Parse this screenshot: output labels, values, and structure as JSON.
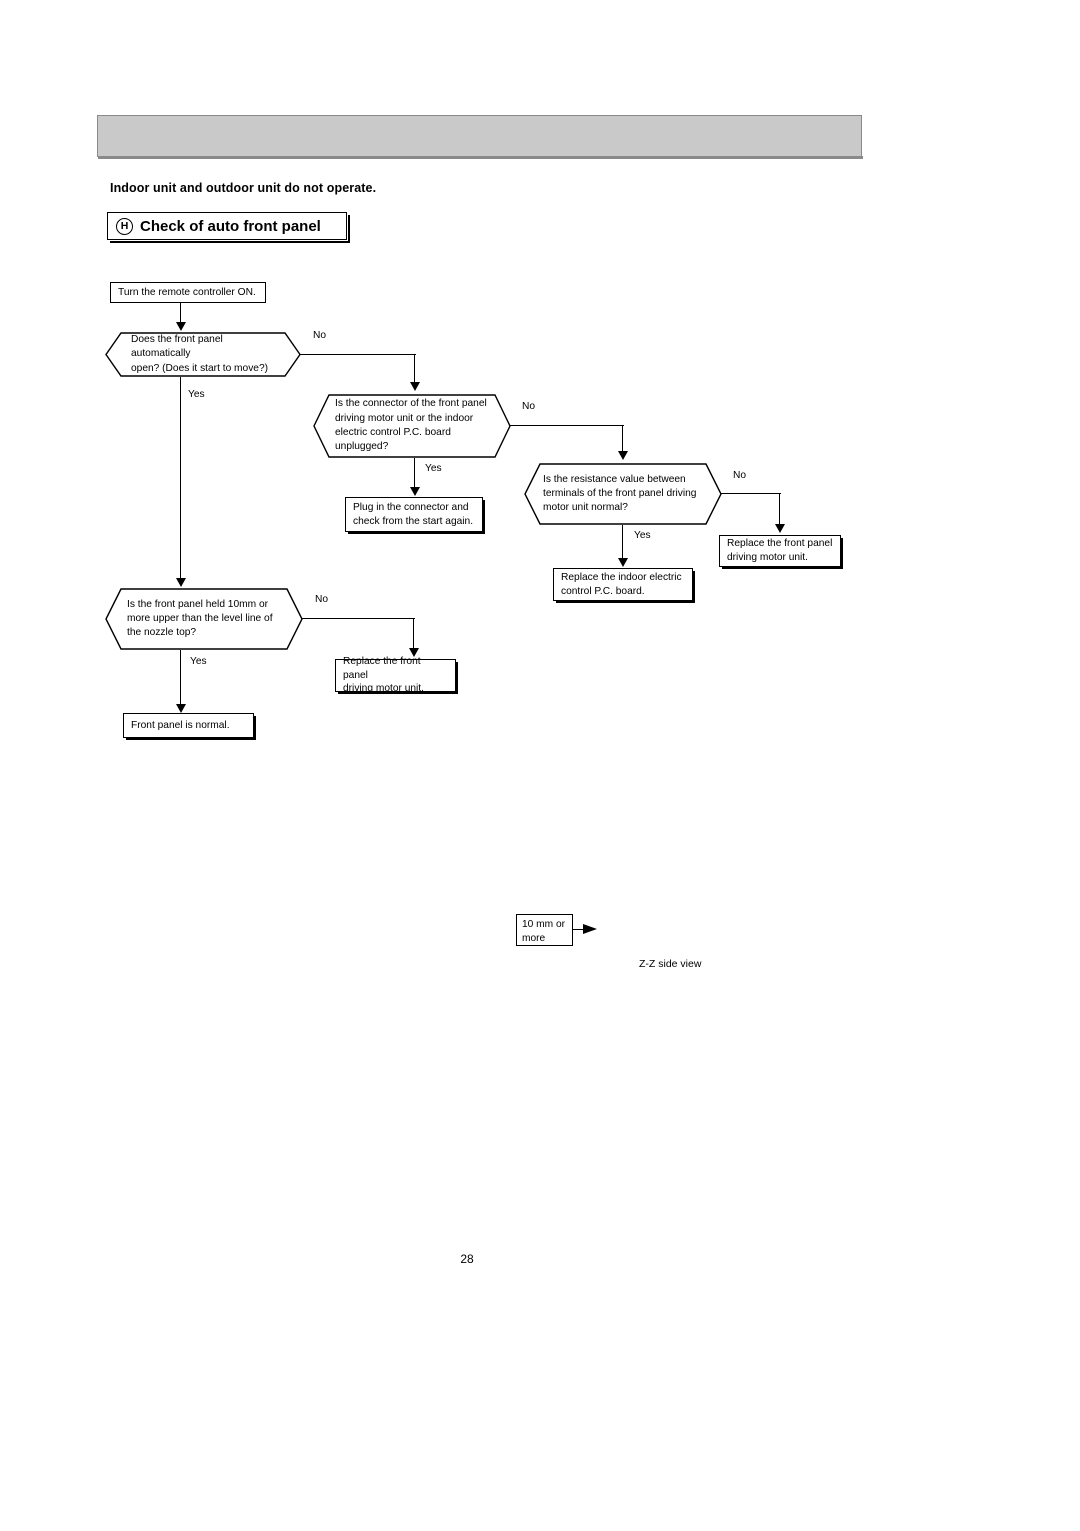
{
  "document": {
    "subtitle": "Indoor unit and outdoor unit do not operate.",
    "section": {
      "badge": "H",
      "title": "Check of auto front panel"
    },
    "page_number": "28"
  },
  "flowchart": {
    "nodes": {
      "start": "Turn the remote controller ON.",
      "decision_panel_opens": "Does the front panel automatically\nopen? (Does it start to move?)",
      "decision_connector": "Is the connector of the front panel\ndriving motor unit or the indoor\nelectric control P.C. board unplugged?",
      "action_plug_in": "Plug in the connector and\ncheck from the start again.",
      "decision_resistance": "Is the resistance value between\nterminals of the front panel driving\nmotor unit normal?",
      "action_replace_pcb": "Replace the indoor electric\ncontrol P.C. board.",
      "action_replace_motor_1": "Replace the front panel\ndriving motor unit.",
      "decision_panel_height": "Is the front panel held 10mm or\nmore upper than the level line of\nthe nozzle top?",
      "action_replace_motor_2": "Replace the front panel\ndriving motor unit.",
      "result_normal": "Front panel is normal."
    },
    "edge_labels": {
      "no_1": "No",
      "yes_1": "Yes",
      "no_2": "No",
      "yes_2": "Yes",
      "no_3": "No",
      "yes_3": "Yes",
      "no_4": "No",
      "yes_4": "Yes"
    }
  },
  "side_view": {
    "dimension_label": "10 mm or\nmore",
    "caption": "Z-Z side view"
  },
  "colors": {
    "header_bar": "#c9c9c9",
    "header_border": "#8a8a8a",
    "line": "#000000",
    "background": "#ffffff"
  }
}
